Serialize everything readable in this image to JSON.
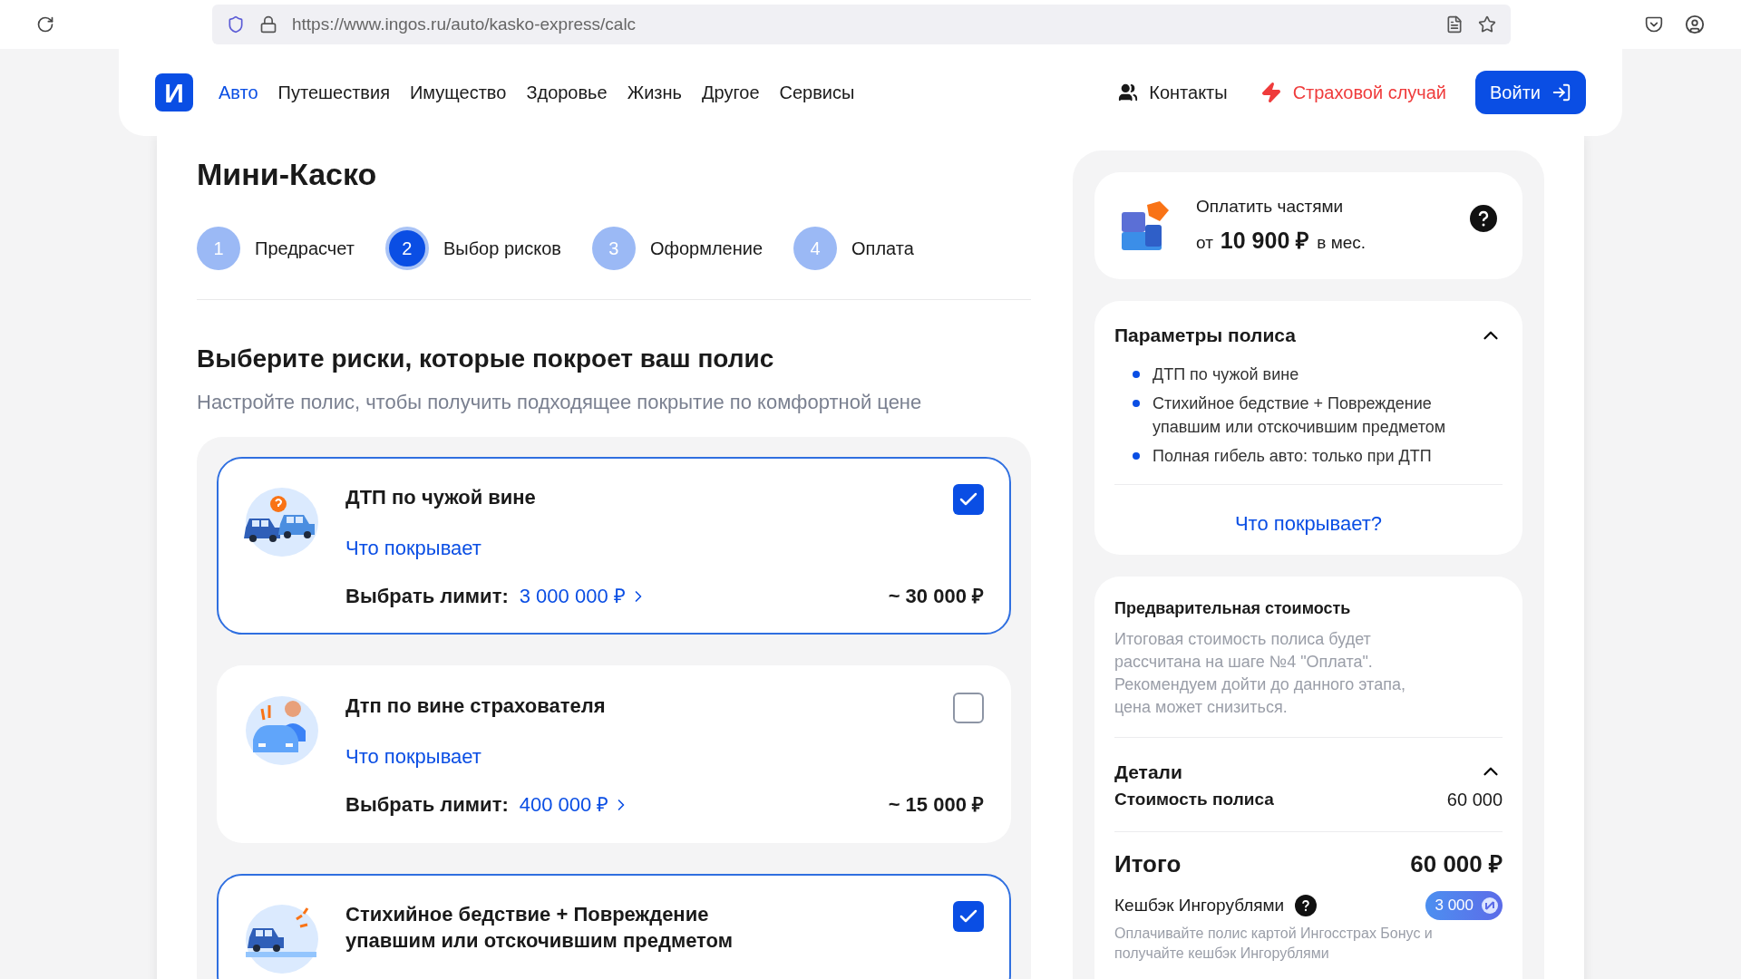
{
  "browser": {
    "url": "https://www.ingos.ru/auto/kasko-express/calc"
  },
  "nav": {
    "logo": "И",
    "items": [
      {
        "label": "Авто",
        "selected": true
      },
      {
        "label": "Путешествия",
        "selected": false
      },
      {
        "label": "Имущество",
        "selected": false
      },
      {
        "label": "Здоровье",
        "selected": false
      },
      {
        "label": "Жизнь",
        "selected": false
      },
      {
        "label": "Другое",
        "selected": false
      },
      {
        "label": "Сервисы",
        "selected": false
      }
    ],
    "contacts": "Контакты",
    "claim": "Страховой случай",
    "login": "Войти"
  },
  "page": {
    "title": "Мини-Каско",
    "steps": [
      {
        "number": "1",
        "label": "Предрасчет",
        "selected": false
      },
      {
        "number": "2",
        "label": "Выбор рисков",
        "selected": true
      },
      {
        "number": "3",
        "label": "Оформление",
        "selected": false
      },
      {
        "number": "4",
        "label": "Оплата",
        "selected": false
      }
    ],
    "heading": "Выберите риски, которые покроет ваш полис",
    "subtitle": "Настройте полис, чтобы получить подходящее покрытие по комфортной цене",
    "risks": [
      {
        "kind": "crash",
        "title": "ДТП по чужой вине",
        "checked": true,
        "link": "Что покрывает",
        "limit_label": "Выбрать лимит:",
        "limit": "3 000 000 ₽",
        "price": "~ 30 000 ₽"
      },
      {
        "kind": "fault",
        "title": "Дтп по вине страхователя",
        "checked": false,
        "link": "Что покрывает",
        "limit_label": "Выбрать лимит:",
        "limit": "400 000 ₽",
        "price": "~ 15 000 ₽"
      },
      {
        "kind": "nature",
        "title": "Стихийное бедствие + Повреждение упавшим или отскочившим предметом",
        "checked": true
      }
    ]
  },
  "sidebar": {
    "installments": {
      "title": "Оплатить частями",
      "prefix": "от",
      "amount": "10 900 ₽",
      "suffix": "в мес."
    },
    "params": {
      "title": "Параметры полиса",
      "expanded": true,
      "items": [
        "ДТП по чужой вине",
        "Стихийное бедствие + Повреждение упавшим или отскочившим предметом",
        "Полная гибель авто: только при ДТП"
      ],
      "link": "Что покрывает?"
    },
    "price": {
      "title": "Предварительная стоимость",
      "note": "Итоговая стоимость полиса будет рассчитана на шаге №4 \"Оплата\". Рекомендуем дойти до данного этапа, цена может снизиться.",
      "details_title": "Детали",
      "details_expanded": true,
      "rows": [
        {
          "label": "Стоимость полиса",
          "value": "60 000"
        }
      ],
      "total_label": "Итого",
      "total_value": "60 000 ₽",
      "cashback_label": "Кешбэк Ингорублями",
      "cashback_value": "3 000",
      "cashback_note": "Оплачивайте полис картой Ингосстрах Бонус и получайте кешбэк Ингорублями"
    }
  }
}
